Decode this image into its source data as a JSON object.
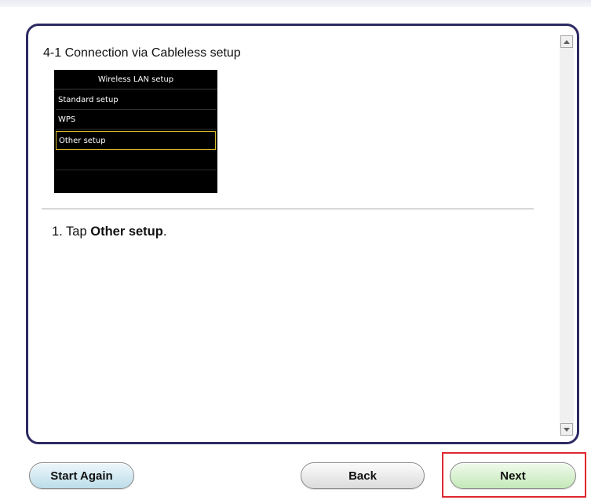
{
  "step": {
    "title": "4-1 Connection via Cableless setup",
    "instruction_prefix": "1. Tap ",
    "instruction_bold": "Other setup",
    "instruction_suffix": "."
  },
  "lcd": {
    "header": "Wireless LAN setup",
    "items": [
      {
        "label": "Standard setup",
        "selected": false
      },
      {
        "label": "WPS",
        "selected": false
      },
      {
        "label": "Other setup",
        "selected": true
      }
    ],
    "colors": {
      "background": "#000000",
      "text": "#ffffff",
      "selection": "#d6b92a"
    }
  },
  "buttons": {
    "start_again": "Start Again",
    "back": "Back",
    "next": "Next"
  },
  "icons": {
    "scroll_up": "triangle-up-icon",
    "scroll_down": "triangle-down-icon"
  },
  "colors": {
    "panel_border": "#2d2a63",
    "highlight": "#e0272f",
    "next_button": "#c4e9b9",
    "start_button": "#bcdde9"
  }
}
